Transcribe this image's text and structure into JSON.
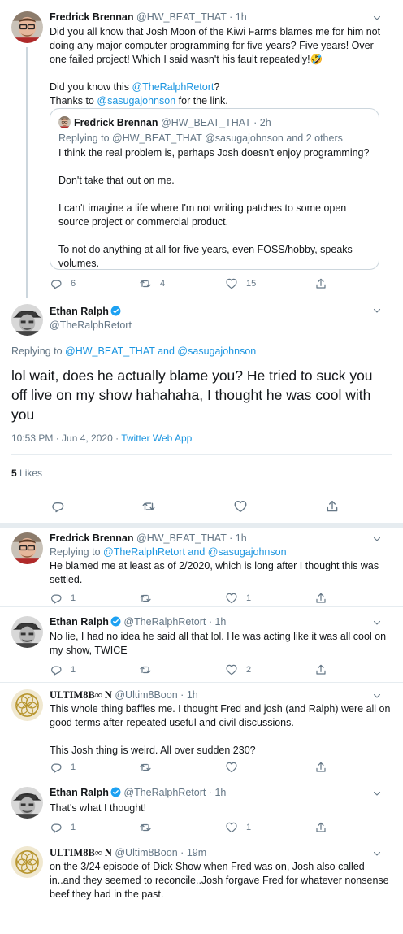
{
  "icons": {
    "reply": "reply-icon",
    "retweet": "retweet-icon",
    "like": "like-icon",
    "share": "share-icon",
    "caret": "chevron-down-icon",
    "verified": "verified-badge-icon"
  },
  "colors": {
    "link": "#1b95e0",
    "secondary": "#657786",
    "border": "#e6ecf0",
    "verified": "#1da1f2"
  },
  "tweet1": {
    "name": "Fredrick Brennan",
    "handle": "@HW_BEAT_THAT",
    "dot": "·",
    "time": "1h",
    "p1": "Did you all know that Josh Moon of the Kiwi Farms blames me for him not doing any major computer programming for five years? Five years! Over one failed project! Which I said wasn't his fault repeatedly!🤣",
    "p2_prefix": "Did you know this ",
    "p2_link": "@TheRalphRetort",
    "p2_suffix": "?",
    "p3_prefix": "Thanks to ",
    "p3_link": "@sasugajohnson",
    "p3_suffix": " for the link.",
    "quote": {
      "name": "Fredrick Brennan",
      "handle": "@HW_BEAT_THAT",
      "dot": "·",
      "time": "2h",
      "replying": "Replying to @HW_BEAT_THAT @sasugajohnson and 2 others",
      "p1": "I think the real problem is, perhaps Josh doesn't enjoy programming?",
      "p2": "Don't take that out on me.",
      "p3": "I can't imagine a life where I'm not writing patches to some open source project or commercial product.",
      "p4": "To not do anything at all for five years, even FOSS/hobby, speaks volumes."
    },
    "replies": "6",
    "retweets": "4",
    "likes": "15"
  },
  "main": {
    "name": "Ethan Ralph",
    "handle": "@TheRalphRetort",
    "replying_prefix": "Replying to ",
    "replying_link": "@HW_BEAT_THAT and @sasugajohnson",
    "text": "lol wait, does he actually blame you? He tried to suck you off live on my show hahahaha, I thought he was cool with you",
    "timestamp": "10:53 PM · Jun 4, 2020 · ",
    "source": "Twitter Web App",
    "likes_count": "5",
    "likes_label": "Likes"
  },
  "reply1": {
    "name": "Fredrick Brennan",
    "handle": "@HW_BEAT_THAT",
    "dot": "·",
    "time": "1h",
    "replying_prefix": "Replying to ",
    "replying_link": "@TheRalphRetort and @sasugajohnson",
    "text": "He blamed me at least as of 2/2020, which is long after I thought this was settled.",
    "replies": "1",
    "retweets": "",
    "likes": "1"
  },
  "reply2": {
    "name": "Ethan Ralph",
    "handle": "@TheRalphRetort",
    "dot": "·",
    "time": "1h",
    "text": "No lie, I had no idea he said all that lol. He was acting like it was all cool on my show, TWICE",
    "replies": "1",
    "retweets": "",
    "likes": "2"
  },
  "reply3": {
    "name": "ULTIM8B∞ N",
    "handle": "@Ultim8Boon",
    "dot": "·",
    "time": "1h",
    "p1": "This whole thing baffles me. I thought Fred and josh (and Ralph) were all on good terms after repeated useful and civil discussions.",
    "p2": "This Josh thing is weird. All over sudden 230?",
    "replies": "1",
    "retweets": "",
    "likes": ""
  },
  "reply4": {
    "name": "Ethan Ralph",
    "handle": "@TheRalphRetort",
    "dot": "·",
    "time": "1h",
    "text": "That's what I thought!",
    "replies": "1",
    "retweets": "",
    "likes": "1"
  },
  "reply5": {
    "name": "ULTIM8B∞ N",
    "handle": "@Ultim8Boon",
    "dot": "·",
    "time": "19m",
    "text": "on the 3/24 episode of Dick Show when Fred was on, Josh also called in..and they seemed to reconcile..Josh forgave Fred for whatever nonsense beef they had in the past."
  }
}
